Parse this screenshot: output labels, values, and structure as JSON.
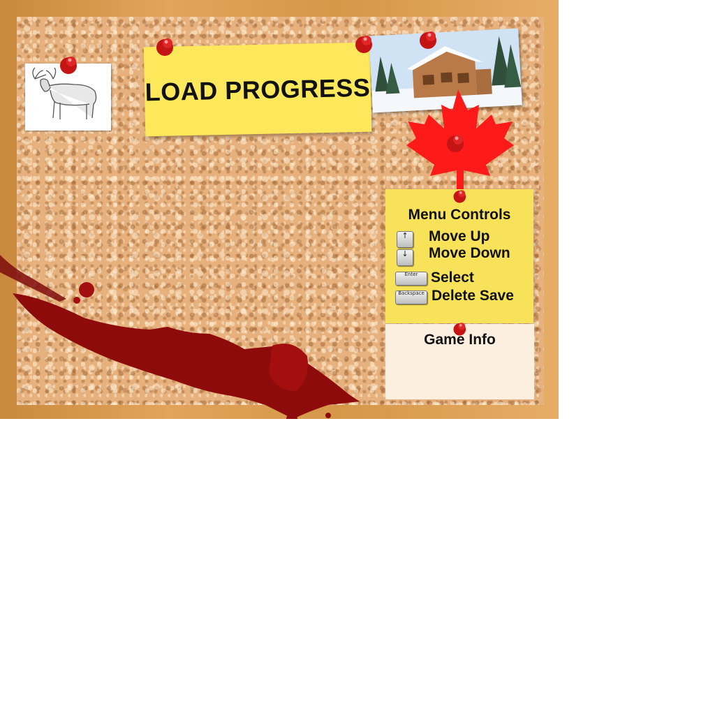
{
  "screen": {
    "title": "LOAD PROGRESS"
  },
  "controls": {
    "heading": "Menu Controls",
    "items": [
      {
        "key_icon": "arrow-up-key-icon",
        "key_glyph": "↑",
        "label": "Move Up"
      },
      {
        "key_icon": "arrow-down-key-icon",
        "key_glyph": "↓",
        "label": "Move Down"
      },
      {
        "key_icon": "enter-key-icon",
        "key_glyph": "Enter",
        "label": "Select"
      },
      {
        "key_icon": "backspace-key-icon",
        "key_glyph": "Backspace",
        "label": "Delete Save"
      }
    ]
  },
  "info": {
    "heading": "Game Info"
  },
  "decor": {
    "board_frame_color": "#d9974b",
    "cork_color": "#e6b17d",
    "sticky_note_color": "#fce85a",
    "pin_color": "#d61a1a",
    "maple_leaf_color": "#ff1a1a",
    "blood_color": "#8e0b0b"
  }
}
